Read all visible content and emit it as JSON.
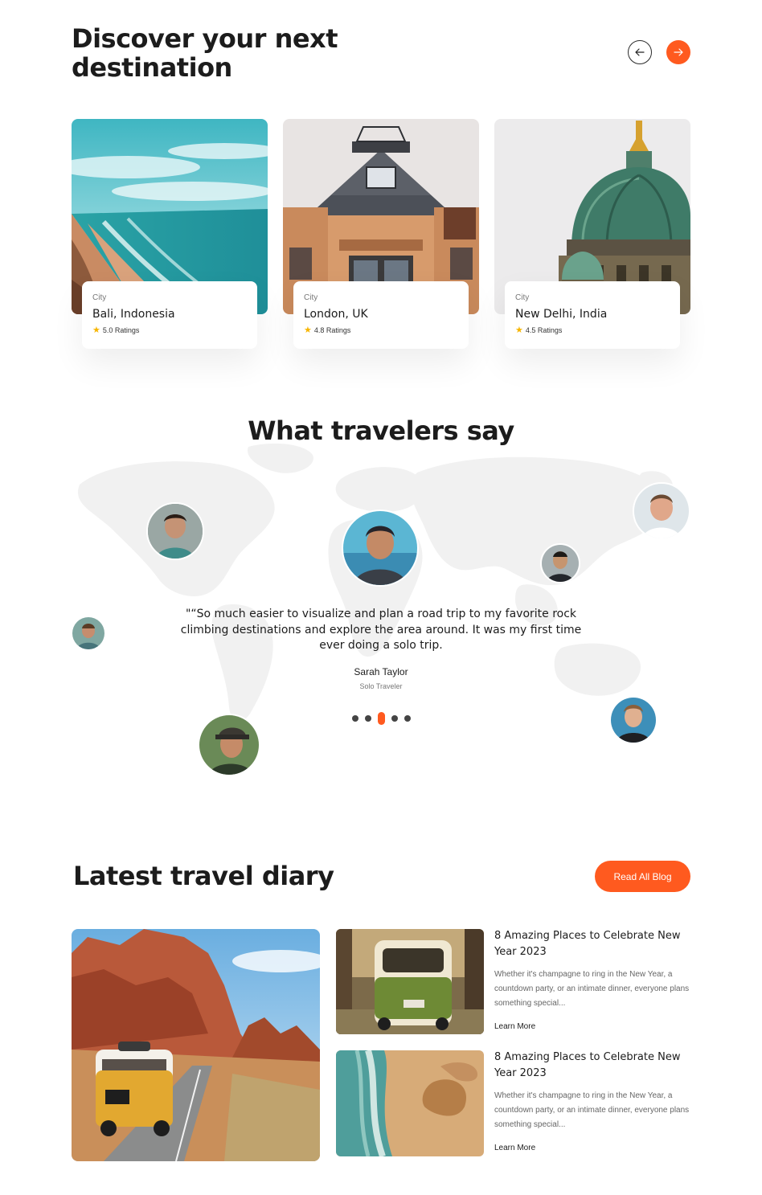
{
  "discover": {
    "title": "Discover your next destination",
    "prev_icon": "arrow-left-icon",
    "next_icon": "arrow-right-icon",
    "accent": "#ff5a1f",
    "cards": [
      {
        "label": "City",
        "name": "Bali, Indonesia",
        "rating": "5.0 Ratings"
      },
      {
        "label": "City",
        "name": "London, UK",
        "rating": "4.8 Ratings"
      },
      {
        "label": "City",
        "name": "New Delhi, India",
        "rating": "4.5 Ratings"
      }
    ]
  },
  "testimonials": {
    "title": "What travelers say",
    "quote": "\"“So much easier to visualize and plan a road trip to my favorite rock climbing destinations and explore the area around. It was my first time ever doing a solo trip.",
    "author": "Sarah Taylor",
    "role": "Solo Traveler",
    "pagination": {
      "count": 5,
      "active": 3
    }
  },
  "diary": {
    "title": "Latest travel diary",
    "read_all_label": "Read All Blog",
    "posts": [
      {
        "title": "8 Amazing Places to Celebrate New Year 2023",
        "excerpt": "Whether it's champagne to ring in the New Year, a countdown party, or an intimate dinner, everyone plans something special...",
        "link": "Learn More"
      },
      {
        "title": "8 Amazing Places to Celebrate New Year 2023",
        "excerpt": "Whether it's champagne to ring in the New Year, a countdown party, or an intimate dinner, everyone plans something special...",
        "link": "Learn More"
      }
    ]
  }
}
